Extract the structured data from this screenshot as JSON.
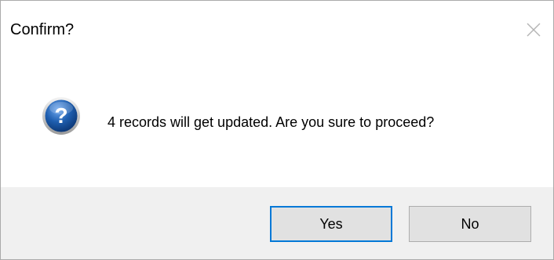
{
  "dialog": {
    "title": "Confirm?",
    "message": "4 records will get updated. Are you sure to proceed?",
    "icon": "question-icon",
    "buttons": {
      "yes": "Yes",
      "no": "No"
    },
    "colors": {
      "footer_background": "#f0f0f0",
      "default_button_border": "#0078d7",
      "icon_blue": "#1f5fb0"
    }
  }
}
